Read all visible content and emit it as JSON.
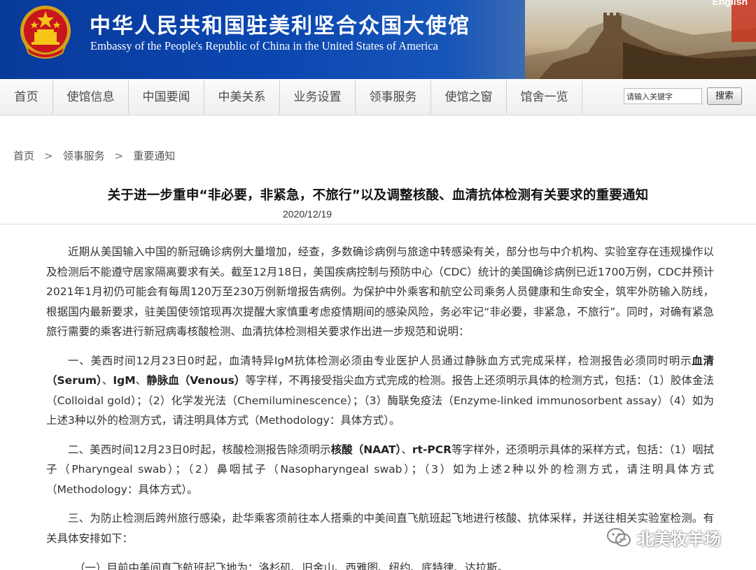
{
  "banner": {
    "title": "中华人民共和国驻美利坚合众国大使馆",
    "subtitle": "Embassy of the People's Republic of China in the United States of America",
    "lang_link": "English"
  },
  "nav": {
    "items": [
      "首页",
      "使馆信息",
      "中国要闻",
      "中美关系",
      "业务设置",
      "领事服务",
      "使馆之窗",
      "馆舍一览"
    ]
  },
  "search": {
    "value": "请输入关键字",
    "button": "搜索"
  },
  "breadcrumb": [
    "首页",
    "领事服务",
    "重要通知"
  ],
  "article": {
    "title": "关于进一步重申“非必要，非紧急，不旅行”以及调整核酸、血清抗体检测有关要求的重要通知",
    "date": "2020/12/19",
    "p1": "近期从美国输入中国的新冠确诊病例大量增加，经查，多数确诊病例与旅途中转感染有关，部分也与中介机构、实验室存在违规操作以及检测后不能遵守居家隔离要求有关。截至12月18日，美国疾病控制与预防中心（CDC）统计的美国确诊病例已近1700万例，CDC并预计2021年1月初仍可能会有每周120万至230万例新增报告病例。为保护中外乘客和航空公司乘务人员健康和生命安全，筑牢外防输入防线，根据国内最新要求，驻美国使领馆现再次提醒大家慎重考虑疫情期间的感染风险，务必牢记“非必要，非紧急，不旅行”。同时，对确有紧急旅行需要的乘客进行新冠病毒核酸检测、血清抗体检测相关要求作出进一步规范和说明：",
    "p2_a": "一、美西时间12月23日0时起，血清特异IgM抗体检测必须由专业医护人员通过静脉血方式完成采样，检测报告必须同时明示",
    "p2_b1": "血清（Serum）",
    "p2_sep1": "、",
    "p2_b2": "IgM",
    "p2_sep2": "、",
    "p2_b3": "静脉血（Venous）",
    "p2_c": "等字样，不再接受指尖血方式完成的检测。报告上还须明示具体的检测方式，包括：（1）胶体金法（Colloidal gold）；（2）化学发光法（Chemiluminescence）；（3）酶联免疫法（Enzyme-linked immunosorbent assay）（4）如为上述3种以外的检测方式，请注明具体方式（Methodology：具体方式）。",
    "p3_a": "二、美西时间12月23日0时起，核酸检测报告除须明示",
    "p3_b1": "核酸（NAAT）",
    "p3_sep": "、",
    "p3_b2": "rt-PCR",
    "p3_c": "等字样外，还须明示具体的采样方式，包括：（1）咽拭子（Pharyngeal swab）；（2）鼻咽拭子（Nasopharyngeal swab）；（3）如为上述2种以外的检测方式，请注明具体方式（Methodology：具体方式）。",
    "p4": "三、为防止检测后跨州旅行感染，赴华乘客须前往本人搭乘的中美间直飞航班起飞地进行核酸、抗体采样，并送往相关实验室检测。有关具体安排如下：",
    "p5": "（一）目前中美间直飞航班起飞地为：洛杉矶、旧金山、西雅图、纽约、底特律、达拉斯。"
  },
  "watermark": "北美牧羊场",
  "colors": {
    "banner_blue": "#0b46b0",
    "nav_bg": "#efefef",
    "title_text": "#111111"
  }
}
